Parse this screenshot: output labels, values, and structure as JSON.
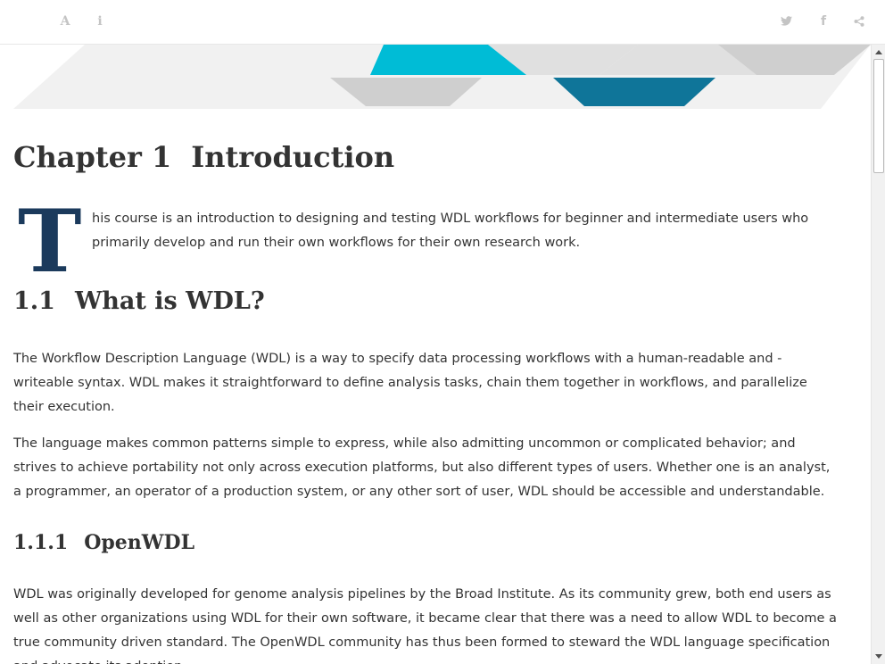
{
  "toolbar": {
    "font_settings_icon": "A",
    "info_icon": "i",
    "twitter_icon": "twitter-icon",
    "facebook_icon": "f",
    "share_icon": "share-icon"
  },
  "banner": {
    "colors": [
      "#f1f1f1",
      "#cfcfcf",
      "#00bcd6",
      "#0f7599",
      "#e0e0e0"
    ]
  },
  "chapter": {
    "number": "Chapter 1",
    "title": "Introduction"
  },
  "intro": {
    "dropcap": "T",
    "line1": "his course is an introduction to designing and testing WDL workflows for beginner and intermediate users who",
    "line2": "primarily develop and run their own workflows for their own research work."
  },
  "section_1_1": {
    "number": "1.1",
    "title": "What is WDL?",
    "p1_lines": [
      "The Workflow Description Language (WDL) is a way to specify data processing workflows with a human-readable and -",
      "writeable syntax. WDL makes it straightforward to define analysis tasks, chain them together in workflows, and parallelize",
      "their execution."
    ],
    "p2_lines": [
      "The language makes common patterns simple to express, while also admitting uncommon or complicated behavior; and",
      "strives to achieve portability not only across execution platforms, but also different types of users. Whether one is an analyst,",
      "a programmer, an operator of a production system, or any other sort of user, WDL should be accessible and understandable."
    ]
  },
  "section_1_1_1": {
    "number": "1.1.1",
    "title": "OpenWDL",
    "p_lines": [
      "WDL was originally developed for genome analysis pipelines by the Broad Institute. As its community grew, both end users as",
      "well as other organizations using WDL for their own software, it became clear that there was a need to allow WDL to become a",
      "true community driven standard. The OpenWDL community has thus been formed to steward the WDL language specification",
      "and advocate its adoption."
    ]
  },
  "colors": {
    "text": "#333333",
    "dropcap": "#1b3a5c",
    "icon": "#c4c4c4"
  }
}
